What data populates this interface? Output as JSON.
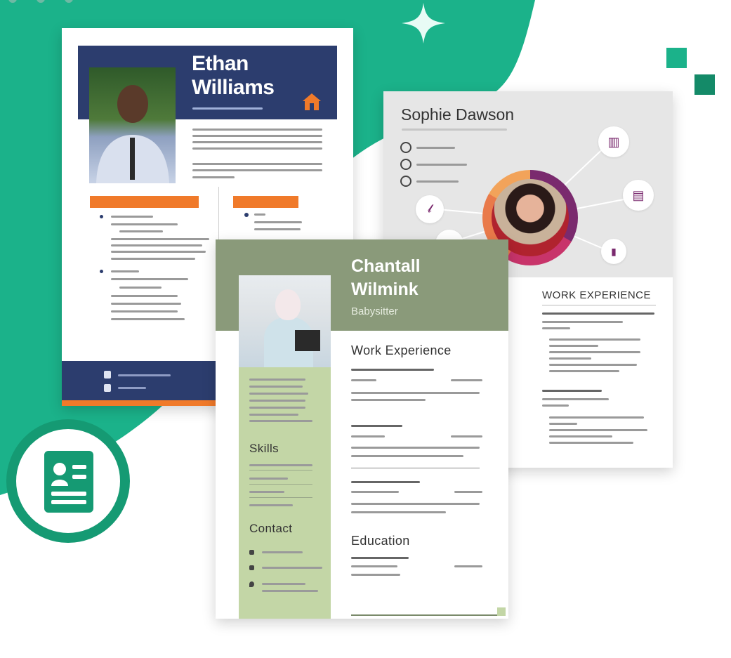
{
  "resumes": {
    "ethan": {
      "name_line1": "Ethan",
      "name_line2": "Williams"
    },
    "sophie": {
      "name": "Sophie Dawson",
      "section_work": "WORK EXPERIENCE"
    },
    "chantall": {
      "name_line1": "Chantall",
      "name_line2": "Wilmink",
      "role": "Babysitter",
      "section_work": "Work Experience",
      "section_education": "Education",
      "section_skills": "Skills",
      "section_contact": "Contact"
    }
  },
  "colors": {
    "brand_green": "#1bb28a",
    "logo_green": "#159a73",
    "navy": "#2c3d6e",
    "orange": "#f07a2a",
    "sage": "#8a9a7a",
    "light_green": "#c3d6a6",
    "plum": "#7a2a6e"
  },
  "icons": {
    "badge": "contact-card-icon",
    "sparkle": "sparkle-icon",
    "house": "house-icon"
  }
}
